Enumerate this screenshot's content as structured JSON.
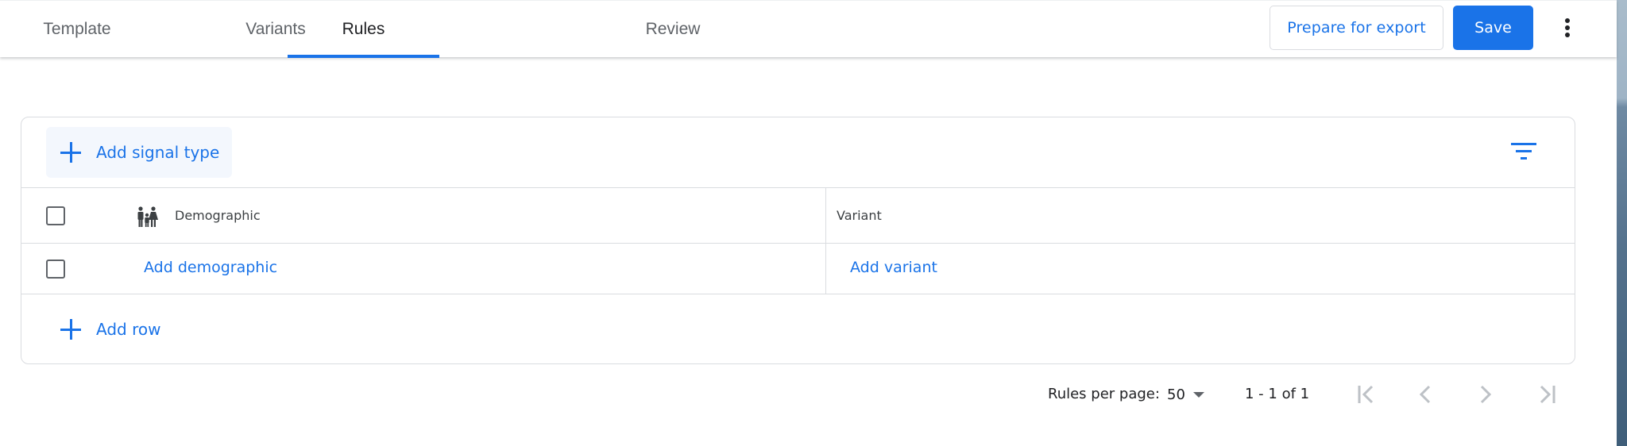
{
  "tabs": [
    {
      "label": "Template",
      "active": false
    },
    {
      "label": "Variants",
      "active": false
    },
    {
      "label": "Rules",
      "active": true
    },
    {
      "label": "Review",
      "active": false
    }
  ],
  "toolbar": {
    "prepare_export_label": "Prepare for export",
    "save_label": "Save",
    "more_icon": "more-vert-icon"
  },
  "colors": {
    "accent": "#1a73e8",
    "chip_background": "#f3f7fd",
    "border": "#dadce0",
    "text_primary": "#202124",
    "text_secondary": "#5f6368"
  },
  "rules_table": {
    "add_signal_type_label": "Add signal type",
    "filter_icon": "filter-icon",
    "columns": [
      {
        "label": "Demographic",
        "icon": "people-icon"
      },
      {
        "label": "Variant"
      }
    ],
    "rows": [
      {
        "demographic": "Add demographic",
        "variant": "Add variant"
      }
    ],
    "add_row_label": "Add row"
  },
  "pagination": {
    "rules_per_page_label": "Rules per page:",
    "rules_per_page_value": "50",
    "range_text": "1 - 1 of 1"
  }
}
